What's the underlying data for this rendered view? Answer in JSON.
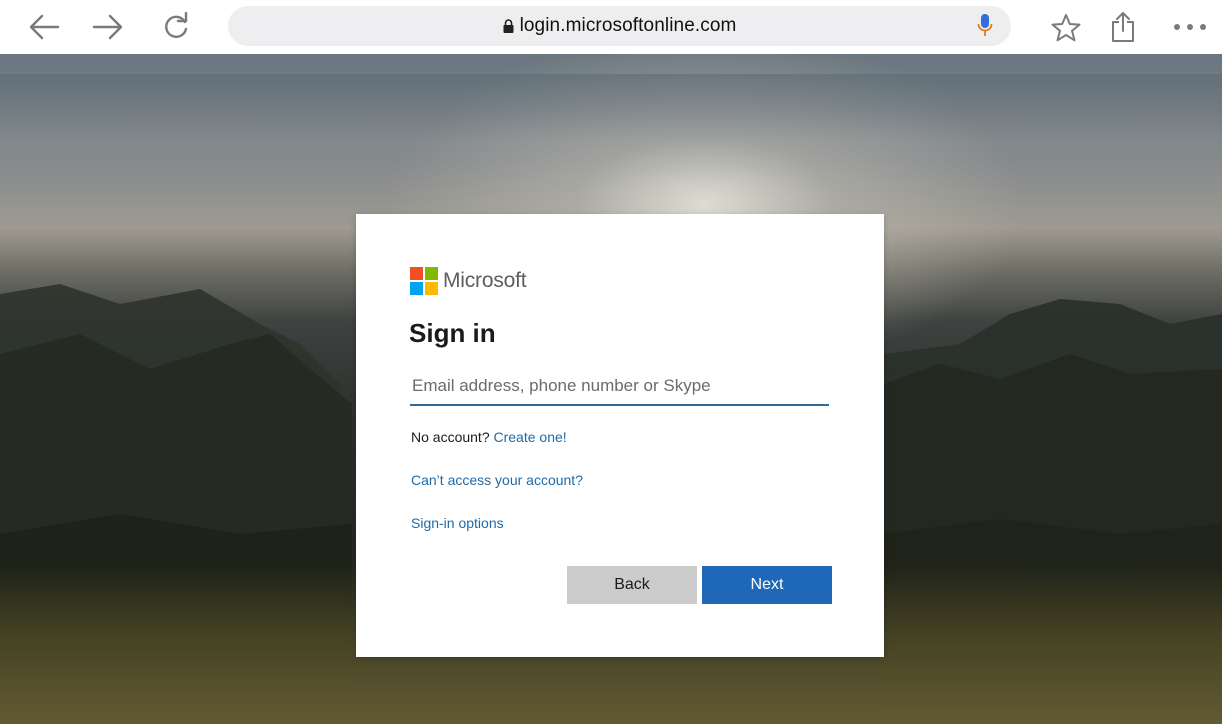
{
  "browser": {
    "url": "login.microsoftonline.com",
    "icons": {
      "back": "back-arrow-icon",
      "forward": "forward-arrow-icon",
      "reload": "reload-icon",
      "lock": "lock-icon",
      "mic": "microphone-icon",
      "bookmark": "star-icon",
      "share": "share-icon",
      "more": "more-dots-icon"
    },
    "mic_color": "#2f6fd6"
  },
  "signin": {
    "brand": "Microsoft",
    "logo_colors": [
      "#f25022",
      "#7fba00",
      "#00a4ef",
      "#ffb900"
    ],
    "title": "Sign in",
    "email_placeholder": "Email address, phone number or Skype",
    "email_value": "",
    "no_account_text": "No account?",
    "create_link": "Create one!",
    "cant_access_link": "Can’t access your account?",
    "signin_options_link": "Sign-in options",
    "back_label": "Back",
    "next_label": "Next",
    "accent_color": "#1f68b7"
  }
}
